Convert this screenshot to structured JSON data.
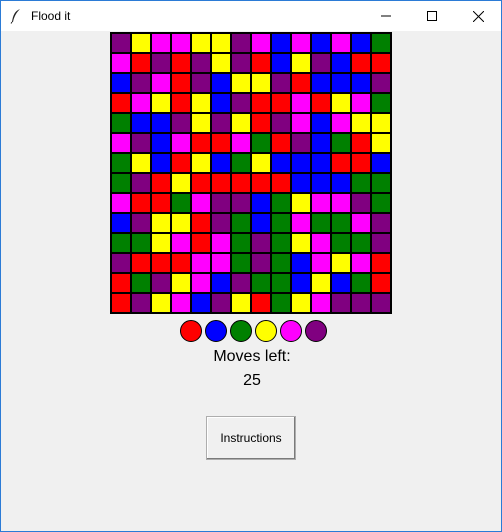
{
  "window": {
    "title": "Flood it"
  },
  "colors": {
    "R": "#ff0000",
    "B": "#0000ff",
    "G": "#008000",
    "Y": "#ffff00",
    "M": "#ff00ff",
    "P": "#800080"
  },
  "board": [
    "PYMMYYPMBMBMBG",
    "MRPRPYPRBYPBRR",
    "BPMRPBYYPRBBBP",
    "RMYRYBPRRMRYMG",
    "GBBPYPYRPMBMY",
    "MPBMRRMGRPBGRY",
    "GYBRYBGYBBBRRB",
    "GPRYRRRRRBBBG",
    "MRRGMPPBGYMMPG",
    "BPYYRPGBGMGGMP",
    "GGYMRMGPGYMGGP",
    "PRRRMMGPGBMYMR",
    "RGPYMBPGGBYBGR",
    "RPYMBPYRGYMPPP"
  ],
  "palette": [
    "R",
    "B",
    "G",
    "Y",
    "M",
    "P"
  ],
  "palette_names": [
    "red-swatch",
    "blue-swatch",
    "green-swatch",
    "yellow-swatch",
    "magenta-swatch",
    "purple-swatch"
  ],
  "moves": {
    "label": "Moves left:",
    "count": "25"
  },
  "buttons": {
    "instructions": "Instructions"
  },
  "icons": {
    "app": "feather-icon",
    "minimize": "minimize-icon",
    "maximize": "maximize-icon",
    "close": "close-icon"
  }
}
